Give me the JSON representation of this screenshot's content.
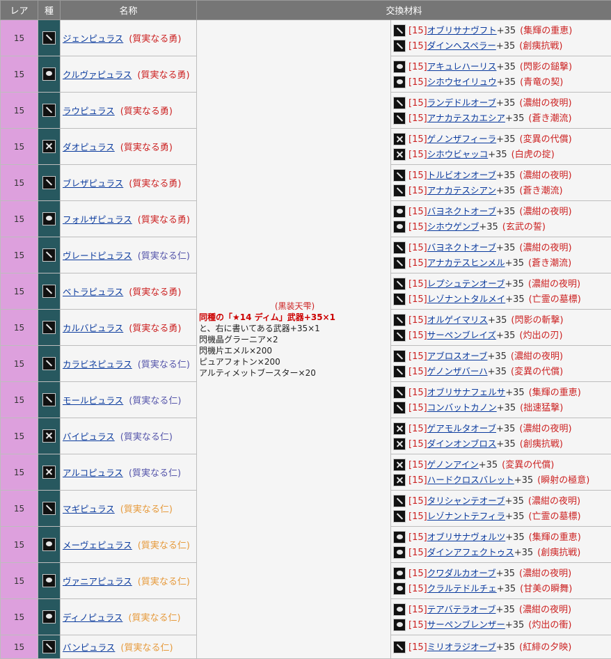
{
  "header": {
    "rarity": "レア",
    "type": "種",
    "name": "名称",
    "materials": "交換材料"
  },
  "middle": {
    "title": "(黒装天雫)",
    "line1": "同種の「★14 ディム」武器+35×1",
    "line2": "と、右に書いてある武器+35×1",
    "line3": "閃機晶グラーニア×2",
    "line4": "閃機片エメル×200",
    "line5": "ピュアフォトン×200",
    "line6": "アルティメットブースター×20"
  },
  "rows": [
    {
      "rarity": "15",
      "icon": "sword-icon",
      "name": "ジェンピュラス",
      "quality": "(質実なる勇)",
      "qcolor": "red",
      "mats": [
        {
          "br": "[15]",
          "name": "オブリサナヴフト",
          "plus": "+35",
          "tag": "(集輝の重恵)",
          "icon": "sword-icon"
        },
        {
          "br": "[15]",
          "name": "ダインヘスペラー",
          "plus": "+35",
          "tag": "(創痍抗戦)",
          "icon": "sword-icon"
        }
      ]
    },
    {
      "rarity": "15",
      "icon": "knuckle-icon",
      "name": "クルヴァピュラス",
      "quality": "(質実なる勇)",
      "qcolor": "red",
      "mats": [
        {
          "br": "[15]",
          "name": "アキュレハーリス",
          "plus": "+35",
          "tag": "(閃影の鎚撃)",
          "icon": "knuckle-icon"
        },
        {
          "br": "[15]",
          "name": "シホウセイリュウ",
          "plus": "+35",
          "tag": "(青竜の契)",
          "icon": "knuckle-icon"
        }
      ]
    },
    {
      "rarity": "15",
      "icon": "partisan-icon",
      "name": "ラウピュラス",
      "quality": "(質実なる勇)",
      "qcolor": "red",
      "mats": [
        {
          "br": "[15]",
          "name": "ランデドルオーブ",
          "plus": "+35",
          "tag": "(濃紺の夜明)",
          "icon": "partisan-icon"
        },
        {
          "br": "[15]",
          "name": "アナカテスカエシア",
          "plus": "+35",
          "tag": "(蒼き潮流)",
          "icon": "partisan-icon"
        }
      ]
    },
    {
      "rarity": "15",
      "icon": "dual-blades-icon",
      "name": "ダオピュラス",
      "quality": "(質実なる勇)",
      "qcolor": "red",
      "mats": [
        {
          "br": "[15]",
          "name": "ゲノンザフィーラ",
          "plus": "+35",
          "tag": "(変異の代償)",
          "icon": "dual-blades-icon"
        },
        {
          "br": "[15]",
          "name": "シホウビャッコ",
          "plus": "+35",
          "tag": "(白虎の掟)",
          "icon": "dual-blades-icon"
        }
      ]
    },
    {
      "rarity": "15",
      "icon": "wired-lance-icon",
      "name": "ブレザピュラス",
      "quality": "(質実なる勇)",
      "qcolor": "red",
      "mats": [
        {
          "br": "[15]",
          "name": "トルビオンオーブ",
          "plus": "+35",
          "tag": "(濃紺の夜明)",
          "icon": "wired-lance-icon"
        },
        {
          "br": "[15]",
          "name": "アナカテスシアン",
          "plus": "+35",
          "tag": "(蒼き潮流)",
          "icon": "wired-lance-icon"
        }
      ]
    },
    {
      "rarity": "15",
      "icon": "double-saber-icon",
      "name": "フォルザピュラス",
      "quality": "(質実なる勇)",
      "qcolor": "red",
      "mats": [
        {
          "br": "[15]",
          "name": "バヨネクトオーブ",
          "plus": "+35",
          "tag": "(濃紺の夜明)",
          "icon": "double-saber-icon"
        },
        {
          "br": "[15]",
          "name": "シホウゲンブ",
          "plus": "+35",
          "tag": "(玄武の誓)",
          "icon": "double-saber-icon"
        }
      ]
    },
    {
      "rarity": "15",
      "icon": "gunslash-icon",
      "name": "ヴレードピュラス",
      "quality": "(質実なる仁)",
      "qcolor": "blue",
      "mats": [
        {
          "br": "[15]",
          "name": "バヨネクトオーブ",
          "plus": "+35",
          "tag": "(濃紺の夜明)",
          "icon": "gunslash-icon"
        },
        {
          "br": "[15]",
          "name": "アナカテスヒンメル",
          "plus": "+35",
          "tag": "(蒼き潮流)",
          "icon": "gunslash-icon"
        }
      ]
    },
    {
      "rarity": "15",
      "icon": "katana-icon",
      "name": "ベトラピュラス",
      "quality": "(質実なる勇)",
      "qcolor": "red",
      "mats": [
        {
          "br": "[15]",
          "name": "レプシュテンオーブ",
          "plus": "+35",
          "tag": "(濃紺の夜明)",
          "icon": "katana-icon"
        },
        {
          "br": "[15]",
          "name": "レゾナントタルメイ",
          "plus": "+35",
          "tag": "(亡霊の墓標)",
          "icon": "katana-icon"
        }
      ]
    },
    {
      "rarity": "15",
      "icon": "dual-daggers-icon",
      "name": "カルバピュラス",
      "quality": "(質実なる勇)",
      "qcolor": "red",
      "mats": [
        {
          "br": "[15]",
          "name": "オルゲイマリス",
          "plus": "+35",
          "tag": "(閃影の斬撃)",
          "icon": "dual-daggers-icon"
        },
        {
          "br": "[15]",
          "name": "サーペンブレイズ",
          "plus": "+35",
          "tag": "(灼出の刃)",
          "icon": "dual-daggers-icon"
        }
      ]
    },
    {
      "rarity": "15",
      "icon": "assault-rifle-icon",
      "name": "カラビネピュラス",
      "quality": "(質実なる仁)",
      "qcolor": "blue",
      "mats": [
        {
          "br": "[15]",
          "name": "アブロスオーブ",
          "plus": "+35",
          "tag": "(濃紺の夜明)",
          "icon": "assault-rifle-icon"
        },
        {
          "br": "[15]",
          "name": "ゲノンザバーハ",
          "plus": "+35",
          "tag": "(変異の代償)",
          "icon": "assault-rifle-icon"
        }
      ]
    },
    {
      "rarity": "15",
      "icon": "launcher-icon",
      "name": "モールピュラス",
      "quality": "(質実なる仁)",
      "qcolor": "blue",
      "mats": [
        {
          "br": "[15]",
          "name": "オブリサナフェルサ",
          "plus": "+35",
          "tag": "(集輝の重恵)",
          "icon": "launcher-icon"
        },
        {
          "br": "[15]",
          "name": "コンバットカノン",
          "plus": "+35",
          "tag": "(拙速猛撃)",
          "icon": "launcher-icon"
        }
      ]
    },
    {
      "rarity": "15",
      "icon": "twin-machinegun-icon",
      "name": "バイピュラス",
      "quality": "(質実なる仁)",
      "qcolor": "blue",
      "mats": [
        {
          "br": "[15]",
          "name": "ゲアモルタオーブ",
          "plus": "+35",
          "tag": "(濃紺の夜明)",
          "icon": "twin-machinegun-icon"
        },
        {
          "br": "[15]",
          "name": "ダインオンブロス",
          "plus": "+35",
          "tag": "(創痍抗戦)",
          "icon": "twin-machinegun-icon"
        }
      ]
    },
    {
      "rarity": "15",
      "icon": "bullet-bow-icon",
      "name": "アルコピュラス",
      "quality": "(質実なる仁)",
      "qcolor": "blue",
      "mats": [
        {
          "br": "[15]",
          "name": "ゲノンアイン",
          "plus": "+35",
          "tag": "(変異の代償)",
          "icon": "bullet-bow-icon"
        },
        {
          "br": "[15]",
          "name": "ハードクロスバレット",
          "plus": "+35",
          "tag": "(瞬射の極意)",
          "icon": "bullet-bow-icon"
        }
      ]
    },
    {
      "rarity": "15",
      "icon": "rod-icon",
      "name": "マギピュラス",
      "quality": "(質実なる仁)",
      "qcolor": "orange",
      "mats": [
        {
          "br": "[15]",
          "name": "タリシャンテオーブ",
          "plus": "+35",
          "tag": "(濃紺の夜明)",
          "icon": "rod-icon"
        },
        {
          "br": "[15]",
          "name": "レゾナントテフィラ",
          "plus": "+35",
          "tag": "(亡霊の墓標)",
          "icon": "rod-icon"
        }
      ]
    },
    {
      "rarity": "15",
      "icon": "talis-icon",
      "name": "メーヴェピュラス",
      "quality": "(質実なる仁)",
      "qcolor": "orange",
      "mats": [
        {
          "br": "[15]",
          "name": "オブリサナヴォルツ",
          "plus": "+35",
          "tag": "(集輝の重恵)",
          "icon": "talis-icon"
        },
        {
          "br": "[15]",
          "name": "ダインアフェクトゥス",
          "plus": "+35",
          "tag": "(創痍抗戦)",
          "icon": "talis-icon"
        }
      ]
    },
    {
      "rarity": "15",
      "icon": "wand-icon",
      "name": "ヴァニアピュラス",
      "quality": "(質実なる仁)",
      "qcolor": "orange",
      "mats": [
        {
          "br": "[15]",
          "name": "クワダルカオーブ",
          "plus": "+35",
          "tag": "(濃紺の夜明)",
          "icon": "wand-icon"
        },
        {
          "br": "[15]",
          "name": "クラルテドルチェ",
          "plus": "+35",
          "tag": "(甘美の瞬舞)",
          "icon": "wand-icon"
        }
      ]
    },
    {
      "rarity": "15",
      "icon": "jet-boots-icon",
      "name": "ディノピュラス",
      "quality": "(質実なる仁)",
      "qcolor": "orange",
      "mats": [
        {
          "br": "[15]",
          "name": "テアバテラオーブ",
          "plus": "+35",
          "tag": "(濃紺の夜明)",
          "icon": "jet-boots-icon"
        },
        {
          "br": "[15]",
          "name": "サーペンブレンザー",
          "plus": "+35",
          "tag": "(灼出の衝)",
          "icon": "jet-boots-icon"
        }
      ]
    },
    {
      "rarity": "15",
      "icon": "takt-icon",
      "name": "バンピュラス",
      "quality": "(質実なる仁)",
      "qcolor": "orange",
      "mats": [
        {
          "br": "[15]",
          "name": "ミリオラジオーブ",
          "plus": "+35",
          "tag": "(紅緋の夕映)",
          "icon": "takt-icon"
        }
      ]
    }
  ]
}
